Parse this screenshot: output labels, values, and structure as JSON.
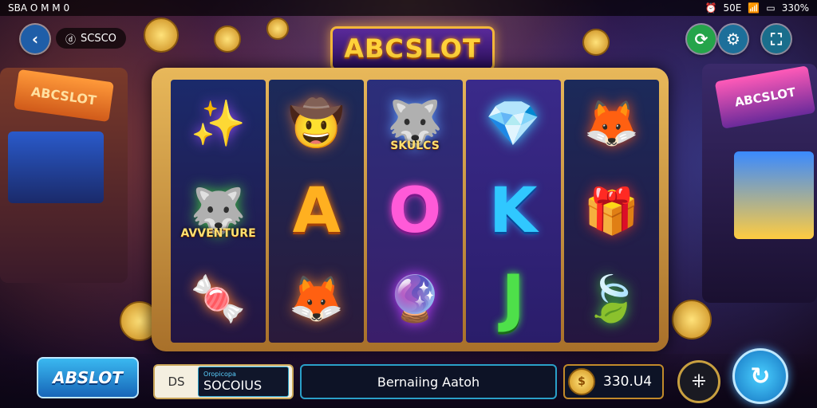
{
  "status_bar": {
    "left_text": "SBA O M M 0",
    "battery_text": "330%",
    "signal_text": "50E"
  },
  "header": {
    "user_label": "SCSCO",
    "logo_text": "ABCSLOT"
  },
  "decor": {
    "left_sign": "ABCSLOT",
    "right_sign": "ABCSLOT"
  },
  "reels": [
    {
      "symbols": [
        {
          "name": "magic-wand-symbol",
          "glyph": "✨",
          "color": "#a050ff"
        },
        {
          "name": "wolf-badge-symbol",
          "glyph": "🐺",
          "color": "#40c040",
          "text": "AVVENTURE"
        },
        {
          "name": "candy-symbol",
          "glyph": "🍬",
          "color": "#ff8030"
        }
      ]
    },
    {
      "symbols": [
        {
          "name": "cowboy-hat-symbol",
          "glyph": "🤠",
          "color": "#b0603a"
        },
        {
          "name": "letter-a-symbol",
          "letter": "A"
        },
        {
          "name": "fox-adventurer-symbol",
          "glyph": "🦊",
          "color": "#d07030"
        }
      ]
    },
    {
      "symbols": [
        {
          "name": "wolf-logo-symbol",
          "glyph": "🐺",
          "color": "#60a0ff",
          "text": "SKULCS"
        },
        {
          "name": "letter-o-symbol",
          "letter": "O"
        },
        {
          "name": "magnifier-gem-symbol",
          "glyph": "🔮",
          "color": "#c040ff"
        }
      ]
    },
    {
      "symbols": [
        {
          "name": "gem-chest-symbol",
          "glyph": "💎",
          "color": "#40d0ff"
        },
        {
          "name": "letter-k-symbol",
          "letter": "K"
        },
        {
          "name": "letter-j-symbol",
          "letter": "J"
        }
      ]
    },
    {
      "symbols": [
        {
          "name": "fox-warrior-symbol",
          "glyph": "🦊",
          "color": "#e05020"
        },
        {
          "name": "treasure-box-symbol",
          "glyph": "🎁",
          "color": "#c03030"
        },
        {
          "name": "green-leaf-gem-symbol",
          "glyph": "🍃",
          "color": "#40c040"
        }
      ]
    }
  ],
  "bottom": {
    "brand_label": "ABSLOT",
    "user_tag": "DS",
    "user_small": "Oropicopa",
    "user_value": "SOCOIUS",
    "status_text": "Bernaiing Aatoh",
    "balance": "330.U4"
  }
}
